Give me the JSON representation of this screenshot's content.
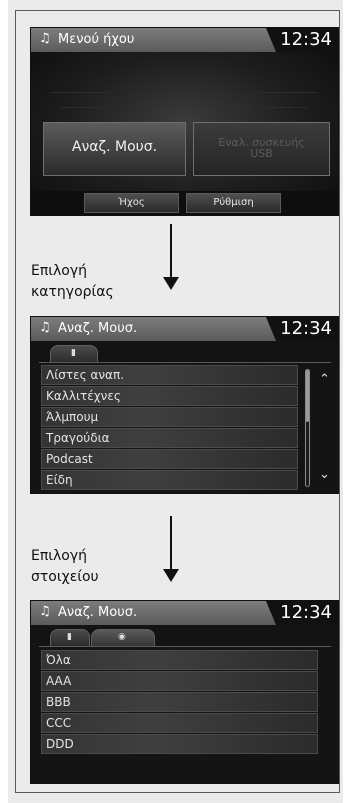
{
  "screen1": {
    "header": {
      "title": "Μενού ήχου",
      "clock": "12:34",
      "note_glyph": "♫"
    },
    "buttons": {
      "browse": "Αναζ. Μουσ.",
      "usb_line1": "Εναλ. συσκευής",
      "usb_line2": "USB"
    },
    "softkeys": {
      "audio": "Ήχος",
      "settings": "Ρύθμιση"
    }
  },
  "step1": {
    "line1": "Επιλογή",
    "line2": "κατηγορίας"
  },
  "screen2": {
    "header": {
      "title": "Αναζ. Μουσ.",
      "clock": "12:34",
      "note_glyph": "♫"
    },
    "tab_glyph": "▮",
    "items": [
      "Λίστες αναπ.",
      "Καλλιτέχνες",
      "Άλμπουμ",
      "Τραγούδια",
      "Podcast",
      "Είδη"
    ],
    "scroll_up_icon": "chevron-up",
    "scroll_down_icon": "chevron-down"
  },
  "step2": {
    "line1": "Επιλογή",
    "line2": "στοιχείου"
  },
  "screen3": {
    "header": {
      "title": "Αναζ. Μουσ.",
      "clock": "12:34",
      "note_glyph": "♫"
    },
    "tab1_glyph": "▮",
    "tab2_glyph": "◉",
    "items": [
      "Όλα",
      "AAA",
      "BBB",
      "CCC",
      "DDD"
    ]
  }
}
